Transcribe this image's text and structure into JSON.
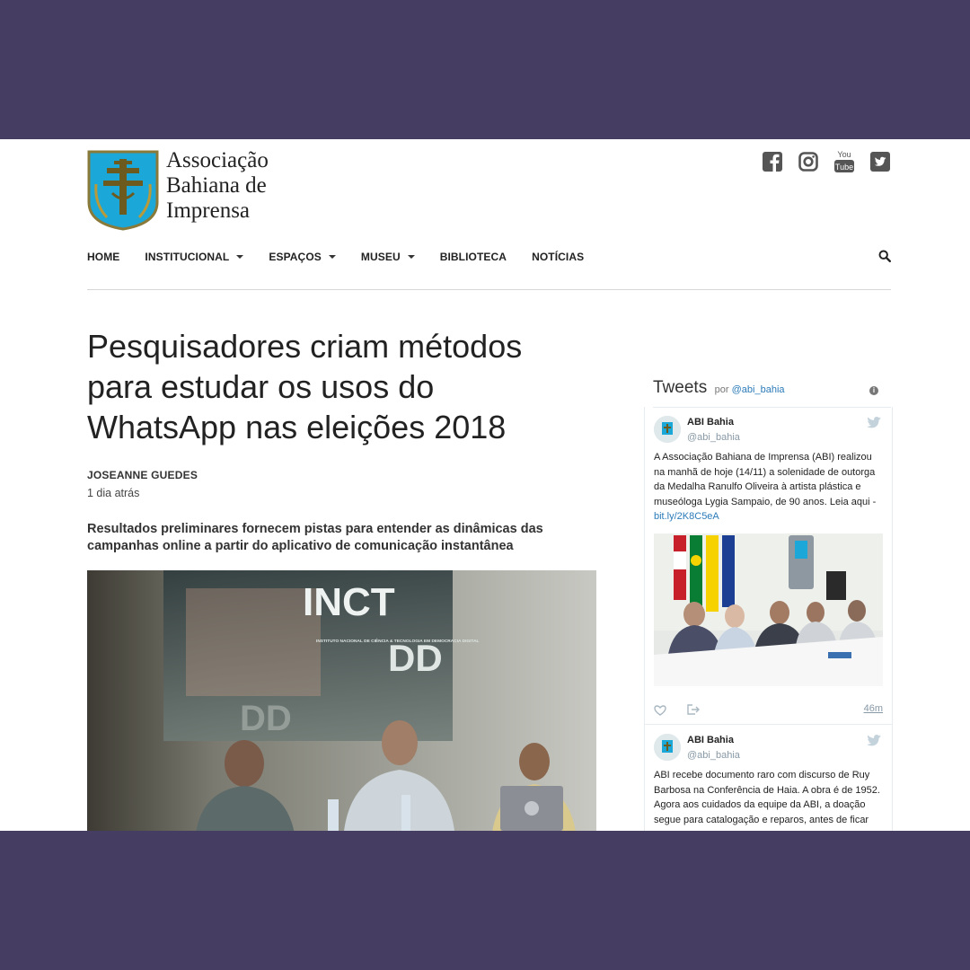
{
  "site": {
    "logo_lines": [
      "Associação",
      "Bahiana de",
      "Imprensa"
    ],
    "social": [
      {
        "icon": "facebook-icon"
      },
      {
        "icon": "instagram-icon"
      },
      {
        "icon": "youtube-icon",
        "text_top": "You",
        "text_bottom": "Tube"
      },
      {
        "icon": "twitter-icon"
      }
    ]
  },
  "nav": {
    "items": [
      {
        "label": "HOME",
        "dropdown": false
      },
      {
        "label": "INSTITUCIONAL",
        "dropdown": true
      },
      {
        "label": "ESPAÇOS",
        "dropdown": true
      },
      {
        "label": "MUSEU",
        "dropdown": true
      },
      {
        "label": "BIBLIOTECA",
        "dropdown": false
      },
      {
        "label": "NOTÍCIAS",
        "dropdown": false
      }
    ],
    "search_icon": "search-icon"
  },
  "article": {
    "title": "Pesquisadores criam métodos para estudar os usos do WhatsApp nas eleições 2018",
    "author": "JOSEANNE GUEDES",
    "time": "1 dia atrás",
    "lead": "Resultados preliminares fornecem pistas para entender as dinâmicas das campanhas online a partir do aplicativo de comunicação instantânea",
    "photo": {
      "screen_top": "INCT",
      "screen_right": "DD",
      "screen_small": "INSTITUTO NACIONAL DE CIÊNCIA & TECNOLOGIA EM DEMOCRACIA DIGITAL",
      "screen_bottom": "DD"
    }
  },
  "tweets": {
    "title": "Tweets",
    "by": "por",
    "handle": "@abi_bahia",
    "items": [
      {
        "name": "ABI Bahia",
        "handle": "@abi_bahia",
        "text": "A Associação Bahiana de Imprensa (ABI) realizou na manhã de hoje (14/11) a solenidade de outorga da Medalha Ranulfo Oliveira à artista plástica e museóloga Lygia Sampaio, de 90 anos. Leia aqui - ",
        "link": "bit.ly/2K8C5eA",
        "time": "46m"
      },
      {
        "name": "ABI Bahia",
        "handle": "@abi_bahia",
        "text": "ABI recebe documento raro com discurso de Ruy Barbosa na Conferência de Haia. A obra é de 1952. Agora aos cuidados da equipe da ABI, a doação segue para catalogação e reparos, antes de ficar"
      }
    ]
  }
}
